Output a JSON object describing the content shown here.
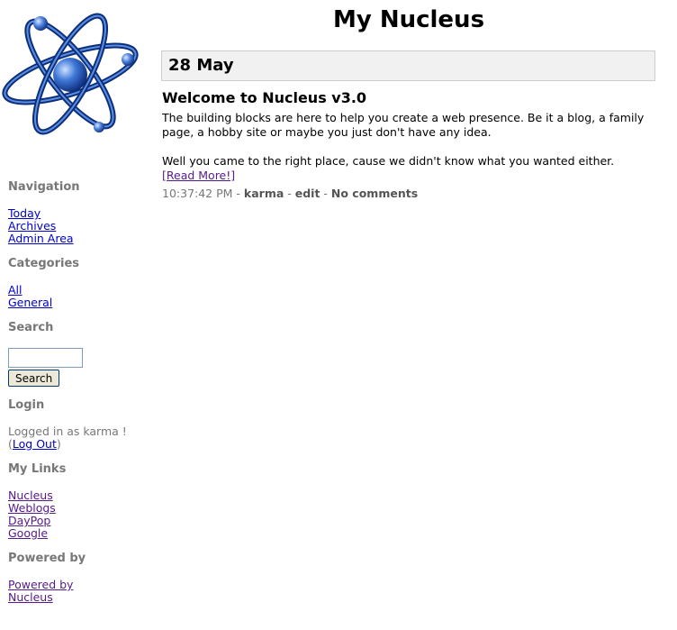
{
  "header": {
    "title": "My Nucleus"
  },
  "day": {
    "date": "28 May"
  },
  "post": {
    "title": "Welcome to Nucleus v3.0",
    "body_1": "The building blocks are here to help you create a web presence. Be it a blog, a family page, a hobby site or maybe you just don't have any idea.",
    "body_2": "Well you came to the right place, cause we didn't know what you wanted either.",
    "read_more": "[Read More!]",
    "time": "10:37:42 PM",
    "author": "karma",
    "edit": "edit",
    "comments": "No comments"
  },
  "sidebar": {
    "navigation": {
      "heading": "Navigation",
      "links": [
        "Today",
        "Archives",
        "Admin Area"
      ]
    },
    "categories": {
      "heading": "Categories",
      "links": [
        "All",
        "General"
      ]
    },
    "search": {
      "heading": "Search",
      "input_value": "",
      "button_label": "Search"
    },
    "login": {
      "heading": "Login",
      "text": "Logged in as karma ! (",
      "logout": "Log Out",
      "close": ")"
    },
    "mylinks": {
      "heading": "My Links",
      "links": [
        "Nucleus",
        "Weblogs",
        "DayPop",
        "Google"
      ]
    },
    "powered": {
      "heading": "Powered by",
      "link": "Powered by Nucleus"
    }
  },
  "colors": {
    "link": "#0000cc",
    "visited": "#551a8b",
    "muted": "#777777",
    "daybox_bg": "#f1f1f1"
  }
}
